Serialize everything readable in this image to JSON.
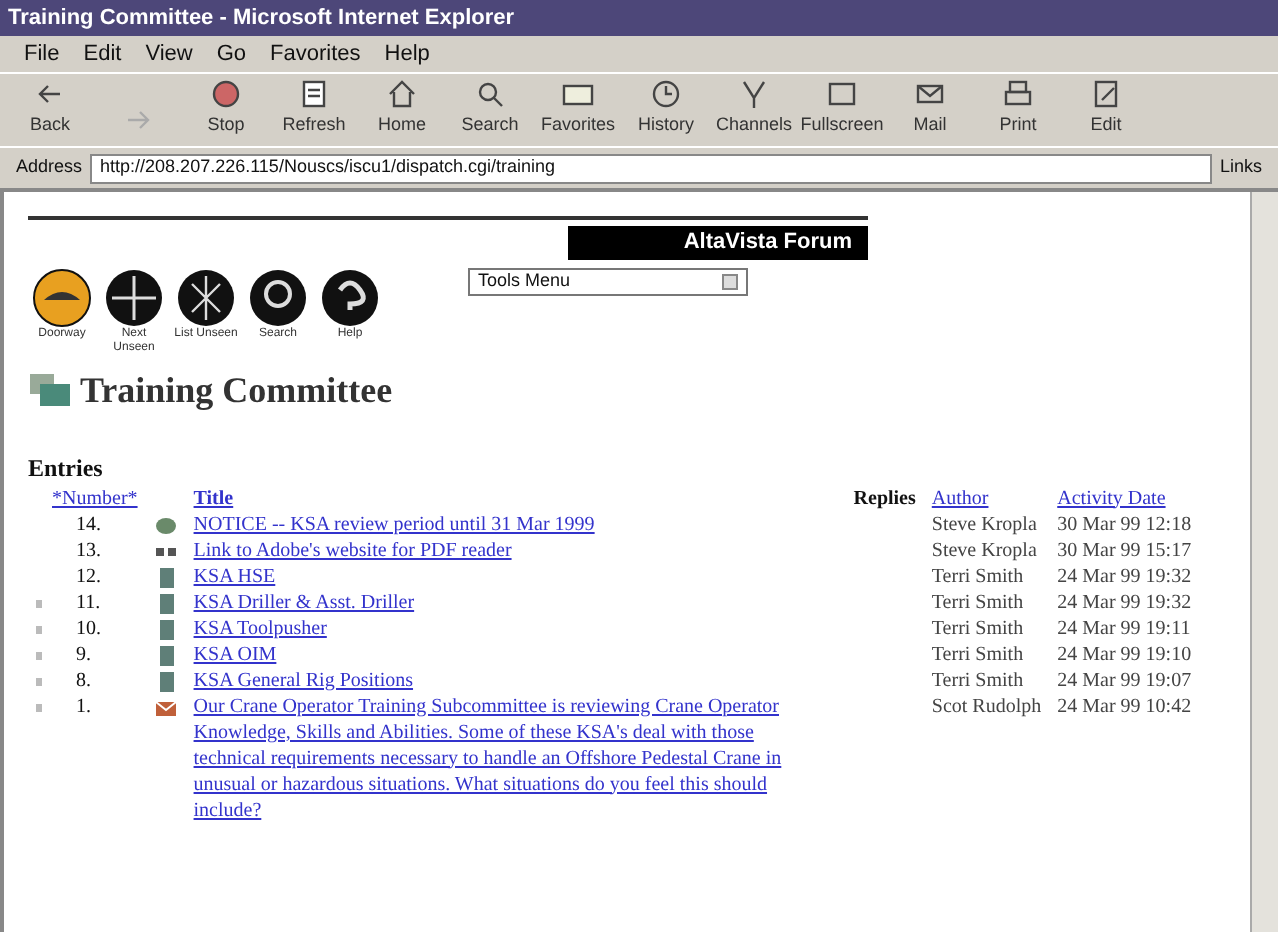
{
  "window": {
    "title": "Training Committee - Microsoft Internet Explorer"
  },
  "menu": [
    "File",
    "Edit",
    "View",
    "Go",
    "Favorites",
    "Help"
  ],
  "toolbar": [
    {
      "label": "Back",
      "kind": "back"
    },
    {
      "kind": "forward"
    },
    {
      "label": "Stop",
      "kind": "stop"
    },
    {
      "label": "Refresh",
      "kind": "refresh"
    },
    {
      "label": "Home",
      "kind": "home"
    },
    {
      "label": "Search",
      "kind": "search"
    },
    {
      "label": "Favorites",
      "kind": "favorites"
    },
    {
      "label": "History",
      "kind": "history"
    },
    {
      "label": "Channels",
      "kind": "channels"
    },
    {
      "label": "Fullscreen",
      "kind": "fullscreen"
    },
    {
      "label": "Mail",
      "kind": "mail"
    },
    {
      "label": "Print",
      "kind": "print"
    },
    {
      "label": "Edit",
      "kind": "edit"
    }
  ],
  "address": {
    "label": "Address",
    "value": "http://208.207.226.115/Nouscs/iscu1/dispatch.cgi/training",
    "links": "Links"
  },
  "forum": {
    "banner": "AltaVista Forum",
    "tools_menu": "Tools Menu",
    "nav": [
      {
        "label": "Doorway",
        "kind": "doorway"
      },
      {
        "label": "Next Unseen",
        "kind": "next"
      },
      {
        "label": "List Unseen",
        "kind": "list"
      },
      {
        "label": "Search",
        "kind": "search"
      },
      {
        "label": "Help",
        "kind": "help"
      }
    ],
    "title": "Training Committee"
  },
  "entries": {
    "heading": "Entries",
    "columns": [
      "*Number*",
      "Title",
      "Replies",
      "Author",
      "Activity Date"
    ],
    "rows": [
      {
        "flagged": false,
        "number": "14.",
        "kind": "globe",
        "title": "NOTICE -- KSA review period until 31 Mar 1999",
        "author": "Steve Kropla",
        "date": "30 Mar 99 12:18"
      },
      {
        "flagged": false,
        "number": "13.",
        "kind": "link",
        "title": "Link to Adobe's website for PDF reader",
        "author": "Steve Kropla",
        "date": "30 Mar 99 15:17"
      },
      {
        "flagged": false,
        "number": "12.",
        "kind": "doc",
        "title": "KSA HSE",
        "author": "Terri Smith",
        "date": "24 Mar 99 19:32"
      },
      {
        "flagged": true,
        "number": "11.",
        "kind": "doc",
        "title": "KSA Driller & Asst. Driller",
        "author": "Terri Smith",
        "date": "24 Mar 99 19:32"
      },
      {
        "flagged": true,
        "number": "10.",
        "kind": "doc",
        "title": "KSA Toolpusher",
        "author": "Terri Smith",
        "date": "24 Mar 99 19:11"
      },
      {
        "flagged": true,
        "number": "9.",
        "kind": "doc",
        "title": "KSA OIM",
        "author": "Terri Smith",
        "date": "24 Mar 99 19:10"
      },
      {
        "flagged": true,
        "number": "8.",
        "kind": "doc",
        "title": "KSA General Rig Positions",
        "author": "Terri Smith",
        "date": "24 Mar 99 19:07"
      },
      {
        "flagged": true,
        "number": "1.",
        "kind": "note",
        "title": "Our Crane Operator Training Subcommittee is reviewing Crane Operator Knowledge, Skills and Abilities. Some of these KSA's deal with those technical requirements necessary to handle an Offshore Pedestal Crane in unusual or hazardous situations. What situations do you feel this should include?",
        "author": "Scot Rudolph",
        "date": "24 Mar 99 10:42"
      }
    ]
  }
}
